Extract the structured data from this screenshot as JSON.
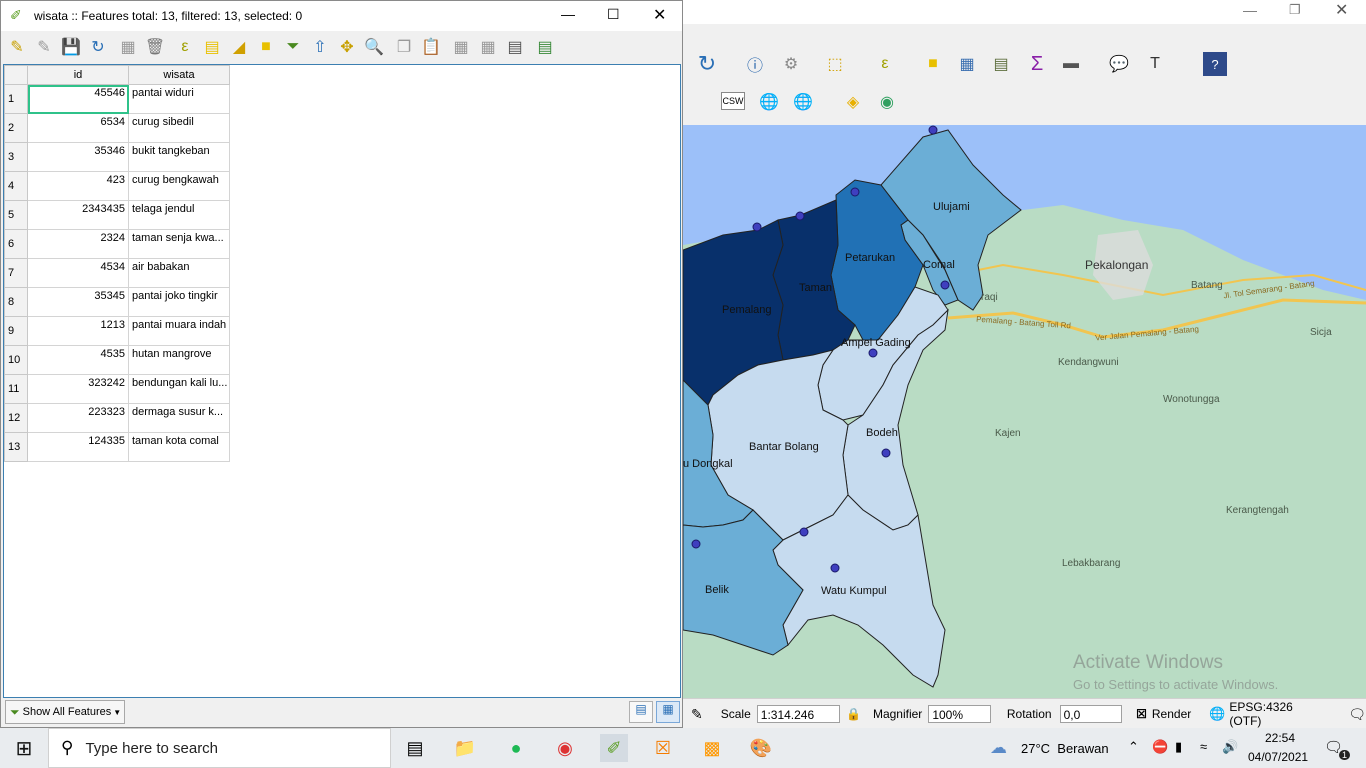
{
  "dialog": {
    "title": "wisata :: Features total: 13, filtered: 13, selected: 0",
    "columns": [
      "id",
      "wisata"
    ],
    "rows": [
      {
        "num": "1",
        "id": "45546",
        "wisata": "pantai widuri"
      },
      {
        "num": "2",
        "id": "6534",
        "wisata": "curug sibedil"
      },
      {
        "num": "3",
        "id": "35346",
        "wisata": "bukit tangkeban"
      },
      {
        "num": "4",
        "id": "423",
        "wisata": "curug bengkawah"
      },
      {
        "num": "5",
        "id": "2343435",
        "wisata": "telaga jendul"
      },
      {
        "num": "6",
        "id": "2324",
        "wisata": "taman senja kwa..."
      },
      {
        "num": "7",
        "id": "4534",
        "wisata": "air babakan"
      },
      {
        "num": "8",
        "id": "35345",
        "wisata": "pantai joko tingkir"
      },
      {
        "num": "9",
        "id": "1213",
        "wisata": "pantai muara indah"
      },
      {
        "num": "10",
        "id": "4535",
        "wisata": "hutan mangrove"
      },
      {
        "num": "11",
        "id": "323242",
        "wisata": "bendungan kali lu..."
      },
      {
        "num": "12",
        "id": "223323",
        "wisata": "dermaga susur k..."
      },
      {
        "num": "13",
        "id": "124335",
        "wisata": "taman kota comal"
      }
    ],
    "filter_button": "Show All Features"
  },
  "map": {
    "regions": [
      "Ulujami",
      "Petarukan",
      "Comal",
      "Taman",
      "Pemalang",
      "Ampel Gading",
      "Bodeh",
      "Bantar Bolang",
      "u Dongkal",
      "Watu Kumpul",
      "Belik"
    ],
    "places": [
      "Pekalongan",
      "Batang",
      "Sicja",
      "Kendangwuni",
      "Wonotungga",
      "Kajen",
      "Kerangtengah",
      "Lebakbarang",
      "raqi"
    ],
    "roads": [
      "Pemalang - Batang Toll Rd",
      "Jl. Tol Semarang - Batang",
      "Ver Jalan Pemalang - Batang"
    ],
    "watermark_title": "Activate Windows",
    "watermark_sub": "Go to Settings to activate Windows."
  },
  "toolbar": {
    "csw_label": "CSW"
  },
  "statusbar": {
    "scale_label": "Scale",
    "scale_value": "1:314.246",
    "magnifier_label": "Magnifier",
    "magnifier_value": "100%",
    "rotation_label": "Rotation",
    "rotation_value": "0,0",
    "render_label": "Render",
    "crs": "EPSG:4326 (OTF)"
  },
  "taskbar": {
    "search_placeholder": "Type here to search",
    "weather": "27°C  Berawan",
    "time": "22:54",
    "date": "04/07/2021",
    "notifications": "1"
  },
  "colors": {
    "dark": "#08306b",
    "mid_dark": "#2171b5",
    "mid": "#6baed6",
    "light": "#c6dbef",
    "sea": "#9cc0f9",
    "land": "#b9dcc4",
    "point": "#3f3fbf"
  }
}
